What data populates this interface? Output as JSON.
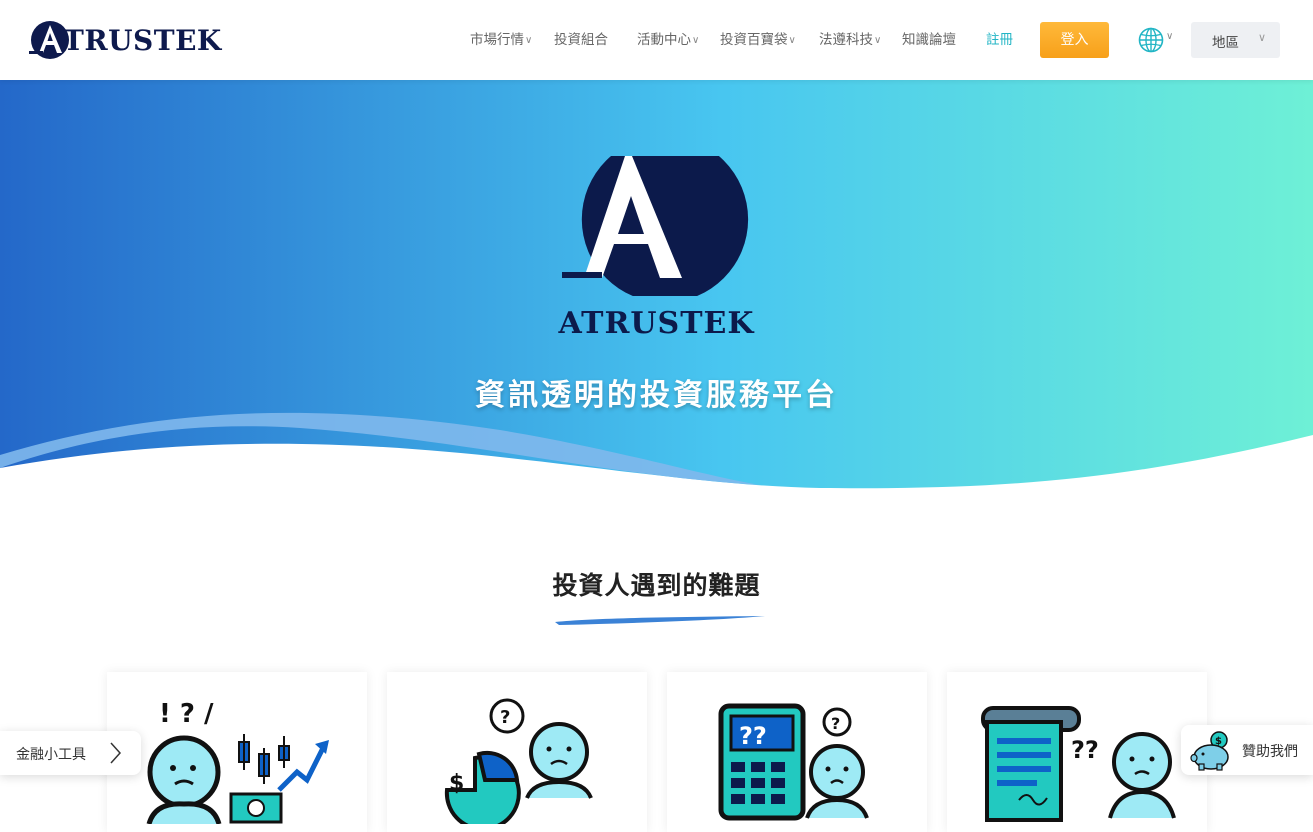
{
  "header": {
    "logo_text": "TRUSTEK",
    "nav": [
      {
        "label": "市場行情",
        "has_dropdown": true
      },
      {
        "label": "投資組合",
        "has_dropdown": false
      },
      {
        "label": "活動中心",
        "has_dropdown": true
      },
      {
        "label": "投資百寶袋",
        "has_dropdown": true
      },
      {
        "label": "法遵科技",
        "has_dropdown": true
      },
      {
        "label": "知識論壇",
        "has_dropdown": false
      },
      {
        "label": "註冊",
        "has_dropdown": false
      }
    ],
    "login_label": "登入",
    "language_icon": "globe-icon",
    "region_label": "地區"
  },
  "hero": {
    "brand": "ATRUSTEK",
    "tagline": "資訊透明的投資服務平台"
  },
  "problems": {
    "title": "投資人遇到的難題",
    "cards": [
      {
        "icon": "confused-investor-chart-icon"
      },
      {
        "icon": "confused-investor-portfolio-icon"
      },
      {
        "icon": "confused-investor-calculator-icon"
      },
      {
        "icon": "confused-investor-document-icon"
      }
    ]
  },
  "widgets": {
    "tools_label": "金融小工具",
    "sponsor_label": "贊助我們"
  },
  "colors": {
    "brand_navy": "#0e1a4d",
    "login_orange": "#f7a81f",
    "register_teal": "#22b5c5",
    "hero_gradient_start": "#2468c9",
    "hero_gradient_mid": "#48c6f0",
    "hero_gradient_end": "#6ef0d6",
    "icon_cyan": "#9eeaf5"
  }
}
